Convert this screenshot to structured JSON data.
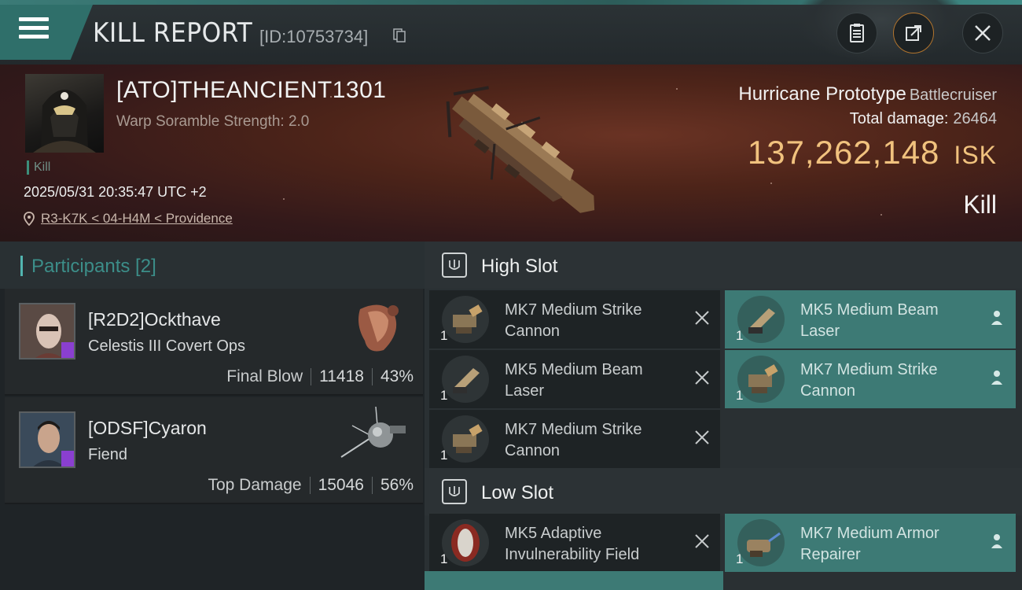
{
  "header": {
    "title": "KILL REPORT",
    "report_id": "[ID:10753734]"
  },
  "victim": {
    "name": "[ATO]THEANCIENT1301",
    "scramble": "Warp Soramble Strength: 2.0",
    "tag": "Kill",
    "datetime": "2025/05/31 20:35:47 UTC +2",
    "location": "R3-K7K < 04-H4M < Providence",
    "ship_name": "Hurricane Prototype",
    "ship_class": "Battlecruiser",
    "total_damage_label": "Total damage:",
    "total_damage": "26464",
    "isk_value": "137,262,148",
    "isk_unit": "ISK",
    "status": "Kill"
  },
  "participants": {
    "label": "Participants [2]",
    "rows": [
      {
        "name": "[R2D2]Ockthave",
        "ship": "Celestis III Covert Ops",
        "stat_label": "Final Blow",
        "damage": "11418",
        "percent": "43%"
      },
      {
        "name": "[ODSF]Cyaron",
        "ship": "Fiend",
        "stat_label": "Top Damage",
        "damage": "15046",
        "percent": "56%"
      }
    ]
  },
  "fitting": {
    "high_slot_label": "High Slot",
    "low_slot_label": "Low Slot",
    "high": [
      {
        "name": "MK7 Medium Strike Cannon",
        "qty": "1",
        "state": "destroyed"
      },
      {
        "name": "MK5 Medium Beam Laser",
        "qty": "1",
        "state": "dropped"
      },
      {
        "name": "MK5 Medium Beam Laser",
        "qty": "1",
        "state": "destroyed"
      },
      {
        "name": "MK7 Medium Strike Cannon",
        "qty": "1",
        "state": "dropped"
      },
      {
        "name": "MK7 Medium Strike Cannon",
        "qty": "1",
        "state": "destroyed"
      }
    ],
    "low": [
      {
        "name": "MK5 Adaptive Invulnerability Field",
        "qty": "1",
        "state": "destroyed"
      },
      {
        "name": "MK7 Medium Armor Repairer",
        "qty": "1",
        "state": "dropped"
      }
    ]
  },
  "colors": {
    "accent_teal": "#3d7a75",
    "isk_gold": "#f1c27e",
    "participants_label": "#3c8e89"
  },
  "icons": [
    "menu-icon",
    "copy-icon",
    "clipboard-icon",
    "share-icon",
    "close-icon",
    "location-pin-icon",
    "slot-icon",
    "destroyed-x-icon",
    "person-icon"
  ]
}
